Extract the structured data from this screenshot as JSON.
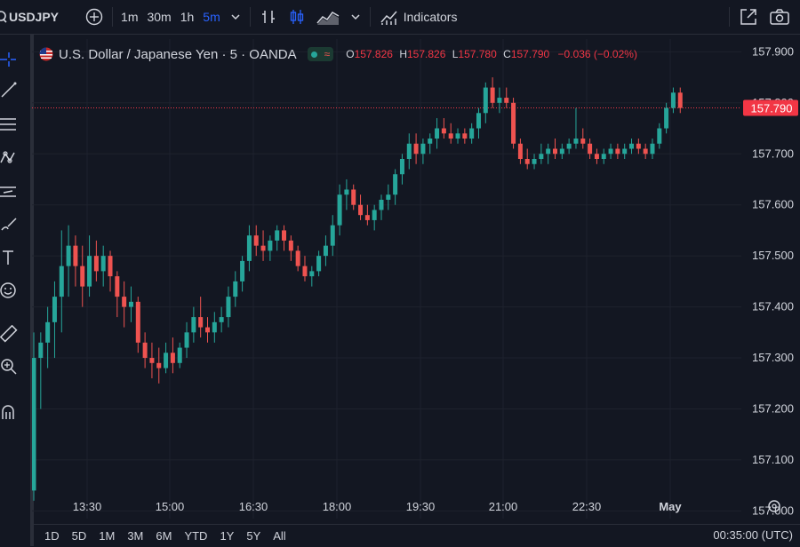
{
  "toolbar": {
    "symbol": "USDJPY",
    "intervals": [
      "1m",
      "30m",
      "1h",
      "5m"
    ],
    "active_interval": "5m",
    "indicators_label": "Indicators"
  },
  "legend": {
    "title": "U.S. Dollar / Japanese Yen · 5 · OANDA",
    "o_label": "O",
    "o_value": "157.826",
    "h_label": "H",
    "h_value": "157.826",
    "l_label": "L",
    "l_value": "157.780",
    "c_label": "C",
    "c_value": "157.790",
    "change": "−0.036 (−0.02%)"
  },
  "price_axis": {
    "ticks": [
      "157.900",
      "157.800",
      "157.700",
      "157.600",
      "157.500",
      "157.400",
      "157.300",
      "157.200",
      "157.100",
      "157.000"
    ],
    "last_price": "157.790"
  },
  "time_axis": {
    "ticks": [
      "13:30",
      "15:00",
      "16:30",
      "18:00",
      "19:30",
      "21:00",
      "22:30",
      "May"
    ]
  },
  "bottom": {
    "ranges": [
      "1D",
      "5D",
      "1M",
      "3M",
      "6M",
      "YTD",
      "1Y",
      "5Y",
      "All"
    ],
    "clock": "00:35:00 (UTC)"
  },
  "colors": {
    "up": "#26a69a",
    "down": "#ef5350",
    "background": "#131722",
    "accent": "#2962ff",
    "grid": "#1e222d"
  },
  "chart_data": {
    "type": "candlestick",
    "ylim": [
      156.985,
      157.925
    ],
    "series": [
      {
        "values": [
          [
            157.04,
            157.35,
            157.02,
            157.3
          ],
          [
            157.3,
            157.35,
            157.2,
            157.33
          ],
          [
            157.33,
            157.4,
            157.28,
            157.37
          ],
          [
            157.37,
            157.45,
            157.3,
            157.42
          ],
          [
            157.42,
            157.55,
            157.35,
            157.48
          ],
          [
            157.48,
            157.56,
            157.42,
            157.52
          ],
          [
            157.52,
            157.54,
            157.44,
            157.48
          ],
          [
            157.48,
            157.52,
            157.4,
            157.44
          ],
          [
            157.44,
            157.54,
            157.42,
            157.5
          ],
          [
            157.5,
            157.53,
            157.45,
            157.47
          ],
          [
            157.47,
            157.52,
            157.44,
            157.5
          ],
          [
            157.5,
            157.51,
            157.43,
            157.46
          ],
          [
            157.46,
            157.47,
            157.38,
            157.42
          ],
          [
            157.42,
            157.45,
            157.36,
            157.4
          ],
          [
            157.4,
            157.44,
            157.37,
            157.41
          ],
          [
            157.41,
            157.42,
            157.31,
            157.33
          ],
          [
            157.33,
            157.35,
            157.28,
            157.3
          ],
          [
            157.3,
            157.33,
            157.26,
            157.29
          ],
          [
            157.29,
            157.32,
            157.25,
            157.28
          ],
          [
            157.28,
            157.33,
            157.27,
            157.31
          ],
          [
            157.31,
            157.34,
            157.27,
            157.29
          ],
          [
            157.29,
            157.33,
            157.28,
            157.32
          ],
          [
            157.32,
            157.37,
            157.3,
            157.35
          ],
          [
            157.35,
            157.4,
            157.33,
            157.38
          ],
          [
            157.38,
            157.42,
            157.34,
            157.36
          ],
          [
            157.36,
            157.38,
            157.33,
            157.35
          ],
          [
            157.35,
            157.39,
            157.33,
            157.37
          ],
          [
            157.37,
            157.4,
            157.35,
            157.38
          ],
          [
            157.38,
            157.44,
            157.36,
            157.42
          ],
          [
            157.42,
            157.47,
            157.4,
            157.45
          ],
          [
            157.45,
            157.5,
            157.43,
            157.49
          ],
          [
            157.49,
            157.56,
            157.47,
            157.54
          ],
          [
            157.54,
            157.56,
            157.5,
            157.52
          ],
          [
            157.52,
            157.55,
            157.49,
            157.51
          ],
          [
            157.51,
            157.54,
            157.49,
            157.53
          ],
          [
            157.53,
            157.56,
            157.51,
            157.55
          ],
          [
            157.55,
            157.56,
            157.51,
            157.53
          ],
          [
            157.53,
            157.54,
            157.49,
            157.51
          ],
          [
            157.51,
            157.52,
            157.47,
            157.48
          ],
          [
            157.48,
            157.5,
            157.45,
            157.46
          ],
          [
            157.46,
            157.48,
            157.44,
            157.47
          ],
          [
            157.47,
            157.51,
            157.46,
            157.5
          ],
          [
            157.5,
            157.54,
            157.48,
            157.52
          ],
          [
            157.52,
            157.58,
            157.5,
            157.56
          ],
          [
            157.56,
            157.64,
            157.54,
            157.62
          ],
          [
            157.62,
            157.65,
            157.59,
            157.63
          ],
          [
            157.63,
            157.64,
            157.59,
            157.6
          ],
          [
            157.6,
            157.62,
            157.57,
            157.58
          ],
          [
            157.58,
            157.6,
            157.56,
            157.57
          ],
          [
            157.57,
            157.6,
            157.55,
            157.59
          ],
          [
            157.59,
            157.62,
            157.57,
            157.61
          ],
          [
            157.61,
            157.64,
            157.59,
            157.62
          ],
          [
            157.62,
            157.67,
            157.6,
            157.66
          ],
          [
            157.66,
            157.7,
            157.64,
            157.69
          ],
          [
            157.69,
            157.74,
            157.67,
            157.72
          ],
          [
            157.72,
            157.74,
            157.68,
            157.7
          ],
          [
            157.7,
            157.73,
            157.68,
            157.72
          ],
          [
            157.72,
            157.74,
            157.7,
            157.73
          ],
          [
            157.73,
            157.77,
            157.71,
            157.75
          ],
          [
            157.75,
            157.77,
            157.73,
            157.74
          ],
          [
            157.74,
            157.76,
            157.72,
            157.73
          ],
          [
            157.73,
            157.75,
            157.72,
            157.74
          ],
          [
            157.74,
            157.75,
            157.72,
            157.73
          ],
          [
            157.73,
            157.76,
            157.72,
            157.75
          ],
          [
            157.75,
            157.79,
            157.73,
            157.78
          ],
          [
            157.78,
            157.84,
            157.76,
            157.83
          ],
          [
            157.83,
            157.85,
            157.79,
            157.8
          ],
          [
            157.8,
            157.83,
            157.78,
            157.81
          ],
          [
            157.81,
            157.83,
            157.79,
            157.8
          ],
          [
            157.8,
            157.81,
            157.71,
            157.72
          ],
          [
            157.72,
            157.73,
            157.68,
            157.69
          ],
          [
            157.69,
            157.71,
            157.67,
            157.68
          ],
          [
            157.68,
            157.7,
            157.67,
            157.69
          ],
          [
            157.69,
            157.72,
            157.68,
            157.7
          ],
          [
            157.7,
            157.72,
            157.68,
            157.71
          ],
          [
            157.71,
            157.73,
            157.69,
            157.7
          ],
          [
            157.7,
            157.72,
            157.69,
            157.71
          ],
          [
            157.71,
            157.73,
            157.7,
            157.72
          ],
          [
            157.72,
            157.79,
            157.71,
            157.73
          ],
          [
            157.73,
            157.75,
            157.71,
            157.72
          ],
          [
            157.72,
            157.73,
            157.69,
            157.7
          ],
          [
            157.7,
            157.71,
            157.68,
            157.69
          ],
          [
            157.69,
            157.71,
            157.68,
            157.7
          ],
          [
            157.7,
            157.72,
            157.69,
            157.71
          ],
          [
            157.71,
            157.72,
            157.69,
            157.7
          ],
          [
            157.7,
            157.72,
            157.69,
            157.71
          ],
          [
            157.71,
            157.73,
            157.7,
            157.72
          ],
          [
            157.72,
            157.73,
            157.7,
            157.71
          ],
          [
            157.71,
            157.72,
            157.69,
            157.7
          ],
          [
            157.7,
            157.73,
            157.69,
            157.72
          ],
          [
            157.72,
            157.76,
            157.71,
            157.75
          ],
          [
            157.75,
            157.8,
            157.74,
            157.79
          ],
          [
            157.79,
            157.83,
            157.78,
            157.82
          ],
          [
            157.82,
            157.83,
            157.78,
            157.79
          ]
        ]
      }
    ]
  }
}
